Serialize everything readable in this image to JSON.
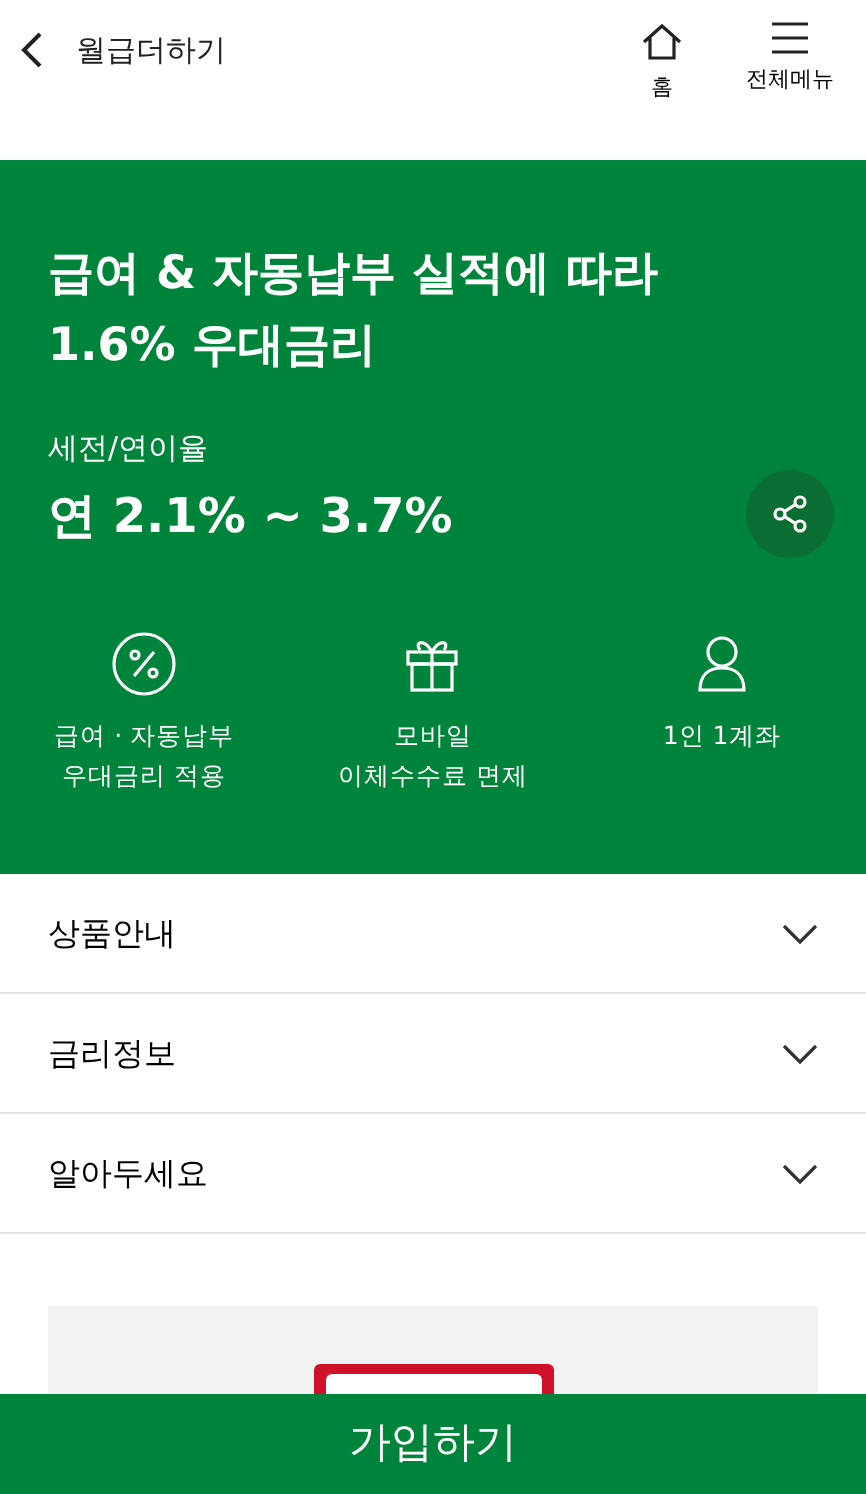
{
  "header": {
    "title": "월급더하기",
    "actions": [
      {
        "kind": "home",
        "label": "홈"
      },
      {
        "kind": "menu",
        "label": "전체메뉴"
      }
    ]
  },
  "hero": {
    "title": "급여 & 자동납부 실적에 따라\n1.6% 우대금리",
    "rate_label": "세전/연이율",
    "rate": "연 2.1% ~ 3.7%",
    "features": [
      {
        "kind": "percent",
        "text": "급여 · 자동납부\n우대금리 적용"
      },
      {
        "kind": "gift",
        "text": "모바일\n이체수수료 면제"
      },
      {
        "kind": "person",
        "text": "1인 1계좌"
      }
    ]
  },
  "sections": [
    {
      "label": "상품안내",
      "expanded": false
    },
    {
      "label": "금리정보",
      "expanded": false
    },
    {
      "label": "알아두세요",
      "expanded": false
    }
  ],
  "join_button": "가입하기"
}
